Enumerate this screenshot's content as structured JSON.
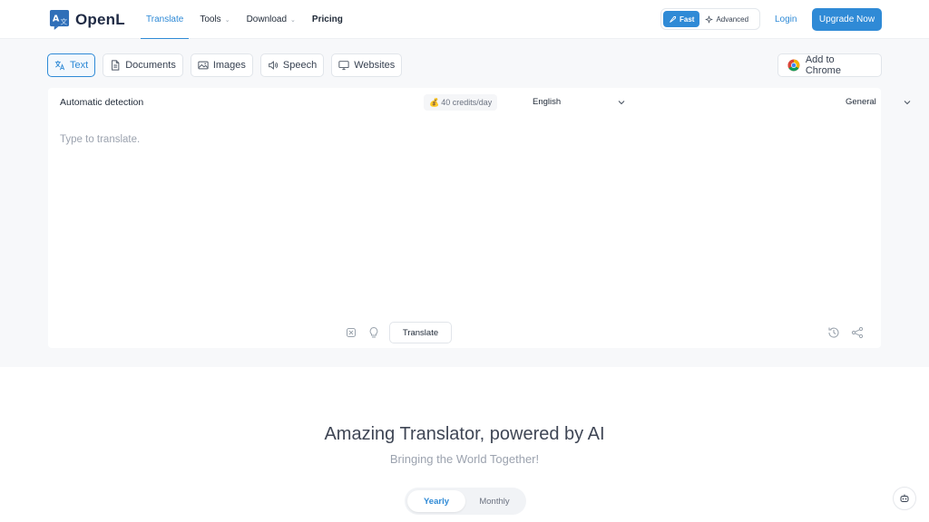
{
  "brand": {
    "name": "OpenL",
    "accent": "#2f8ad6"
  },
  "nav": {
    "translate": "Translate",
    "tools": "Tools",
    "download": "Download",
    "pricing": "Pricing"
  },
  "mode": {
    "fast": "Fast",
    "advanced": "Advanced",
    "selected": "Fast"
  },
  "auth": {
    "login": "Login",
    "upgrade": "Upgrade Now"
  },
  "tabs": [
    {
      "label": "Text",
      "icon": "translate-icon",
      "active": true
    },
    {
      "label": "Documents",
      "icon": "document-icon"
    },
    {
      "label": "Images",
      "icon": "image-icon"
    },
    {
      "label": "Speech",
      "icon": "speaker-icon"
    },
    {
      "label": "Websites",
      "icon": "monitor-icon"
    }
  ],
  "chrome": {
    "label": "Add to Chrome",
    "icon": "chrome-icon"
  },
  "editor": {
    "source_language": "Automatic detection",
    "credits": "40 credits/day",
    "target_language": "English",
    "domain": "General",
    "placeholder": "Type to translate.",
    "translate_button": "Translate"
  },
  "hero": {
    "title": "Amazing Translator, powered by AI",
    "subtitle": "Bringing the World Together!"
  },
  "billing": {
    "yearly": "Yearly",
    "monthly": "Monthly",
    "selected": "Yearly"
  }
}
